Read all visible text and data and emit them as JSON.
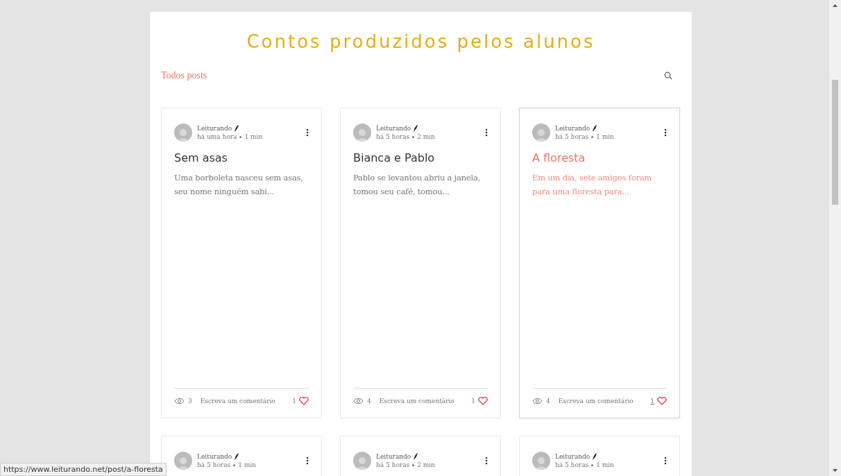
{
  "blog": {
    "title": "Contos produzidos pelos alunos",
    "filter": "Todos posts"
  },
  "posts": [
    {
      "author": "Leiturando",
      "time": "há uma hora",
      "read_time": "1 min",
      "title": "Sem asas",
      "excerpt": "Uma borboleta nasceu sem asas, seu nome ninguém sabi...",
      "views": "3",
      "comment_label": "Escreva um comentário",
      "likes": "1",
      "hovered": false
    },
    {
      "author": "Leiturando",
      "time": "há 5 horas",
      "read_time": "2 min",
      "title": "Bianca e Pablo",
      "excerpt": "Pablo se levantou abriu a janela, tomou seu café, tomou...",
      "views": "4",
      "comment_label": "Escreva um comentário",
      "likes": "1",
      "hovered": false
    },
    {
      "author": "Leiturando",
      "time": "há 5 horas",
      "read_time": "1 min",
      "title": "A floresta",
      "excerpt": "Em um dia, sete amigos foram para uma floresta para...",
      "views": "4",
      "comment_label": "Escreva um comentário",
      "likes": "1",
      "hovered": true
    },
    {
      "author": "Leiturando",
      "time": "há 5 horas",
      "read_time": "1 min",
      "hovered": false
    },
    {
      "author": "Leiturando",
      "time": "há 5 horas",
      "read_time": "2 min",
      "hovered": false
    },
    {
      "author": "Leiturando",
      "time": "há 5 horas",
      "read_time": "1 min",
      "hovered": false
    }
  ],
  "status_bar": {
    "url": "https://www.leiturando.net/post/a-floresta"
  }
}
